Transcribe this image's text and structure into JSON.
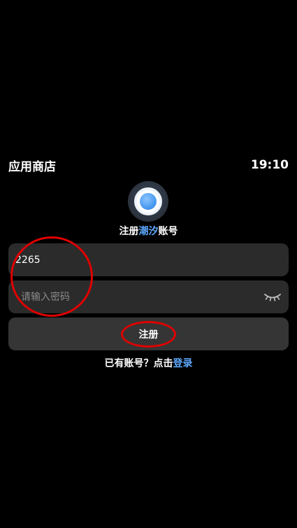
{
  "status_bar": {
    "app_name": "应用商店",
    "time": "19:10"
  },
  "header": {
    "title_prefix": "注册",
    "title_accent": "潮汐",
    "title_suffix": "账号",
    "accent_color": "#5da9ff"
  },
  "form": {
    "username_value": "2265",
    "password_placeholder": "请输入密码",
    "password_toggle_icon": "eye-closed-icon",
    "register_label": "注册"
  },
  "footer": {
    "prompt_text": "已有账号？点击",
    "login_link_text": "登录"
  },
  "annotations": {
    "color": "#e00000"
  }
}
